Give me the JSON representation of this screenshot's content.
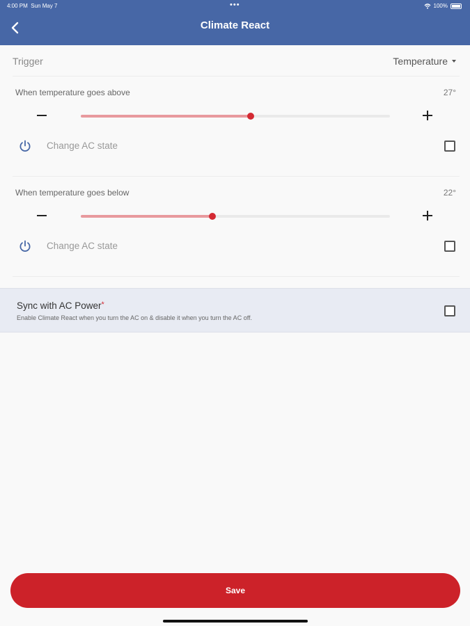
{
  "status_bar": {
    "time": "4:00 PM",
    "date": "Sun May 7",
    "dots": "•••",
    "battery": "100%"
  },
  "header": {
    "title": "Climate React"
  },
  "trigger": {
    "label": "Trigger",
    "value": "Temperature"
  },
  "above": {
    "label": "When temperature goes above",
    "value": "27°",
    "slider_fraction": 0.55,
    "action_label": "Change AC state"
  },
  "below": {
    "label": "When temperature goes below",
    "value": "22°",
    "slider_fraction": 0.425,
    "action_label": "Change AC state"
  },
  "sync": {
    "title": "Sync with AC Power",
    "asterisk": "*",
    "description": "Enable Climate React when you turn the AC on & disable it when you turn the AC off."
  },
  "save_label": "Save",
  "colors": {
    "header": "#4767a6",
    "accent": "#cc2229",
    "slider_track": "#e89a9e",
    "power_icon": "#4767a6",
    "panel": "#e8ebf3"
  },
  "icons": {
    "back": "chevron-left-icon",
    "power": "power-icon",
    "dropdown": "caret-down-icon",
    "wifi": "wifi-icon",
    "battery": "battery-icon"
  }
}
